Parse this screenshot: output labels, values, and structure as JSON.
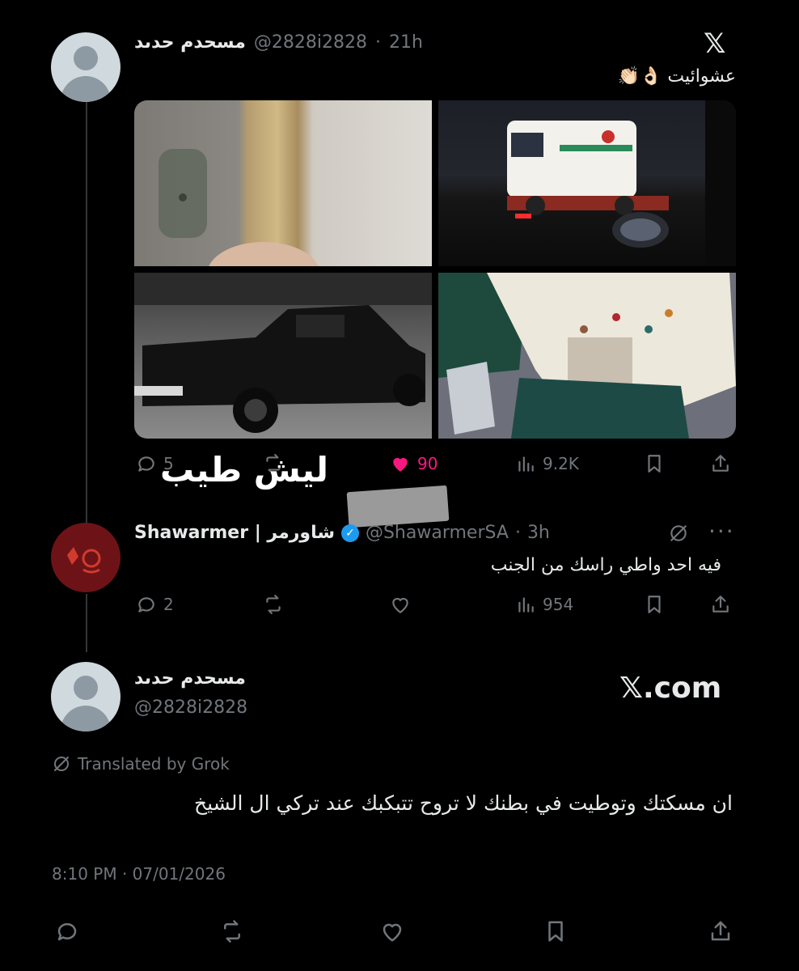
{
  "tweet1": {
    "display_name": "مسحدم حدىد",
    "handle": "@2828i2828",
    "time": "21h",
    "text": "عشوائيت 👌🏻👏🏻",
    "stats": {
      "replies": "5",
      "likes": "90",
      "views": "9.2K"
    }
  },
  "overlay": {
    "text": "ليش طيب"
  },
  "reply": {
    "display_name": "Shawarmer | شاورمر",
    "handle": "@ShawarmerSA",
    "time": "3h",
    "text": "فيه احد واطي راسك من الجنب",
    "stats": {
      "replies": "2",
      "views": "954"
    }
  },
  "quote": {
    "display_name": "مسحدم حدىد",
    "handle": "@2828i2828",
    "translated_by": "Translated by Grok",
    "text": "ان مسكتك وتوطيت في بطنك لا تروح تتبكبك عند تركي ال الشيخ",
    "timestamp": "8:10 PM · 07/01/2026"
  },
  "watermark": {
    "text": "𝕏.com",
    "logo": "𝕏"
  },
  "colors": {
    "like": "#f91880",
    "verified": "#1d9bf0",
    "muted": "#71767b"
  }
}
